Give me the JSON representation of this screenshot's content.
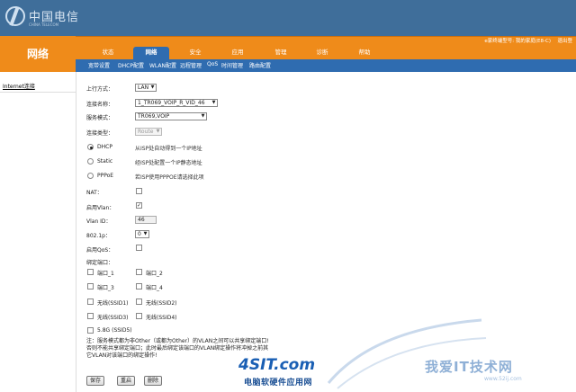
{
  "brand": {
    "name": "中国电信",
    "tagline": "CHINA TELECOM"
  },
  "header": {
    "section_title": "网络",
    "device_info": "e家终端型号: 我的家庭(E8-C)",
    "logout": "退出登"
  },
  "tabs": [
    "状态",
    "网络",
    "安全",
    "应用",
    "管理",
    "诊断",
    "帮助"
  ],
  "active_tab": "网络",
  "subnav": [
    "宽带设置",
    "DHCP配置",
    "WLAN配置",
    "远程管理",
    "QoS",
    "时间管理",
    "路由配置"
  ],
  "sidebar": {
    "link": "Internet连接"
  },
  "form": {
    "uplink_label": "上行方式：",
    "uplink_value": "LAN",
    "conn_name_label": "连接名称：",
    "conn_name_value": "1_TR069_VOIP_R_VID_46",
    "service_mode_label": "服务模式：",
    "service_mode_value": "TR069,VOIP",
    "conn_type_label": "连接类型：",
    "conn_type_value": "Route",
    "dhcp_label": "DHCP",
    "dhcp_desc": "从ISP处自动得到一个IP地址",
    "static_label": "Static",
    "static_desc": "经ISP处配置一个IP静态地址",
    "pppoe_label": "PPPoE",
    "pppoe_desc": "若ISP使用PPPOE请选择此项",
    "nat_label": "NAT：",
    "vlan_enable_label": "启用Vlan：",
    "vlan_id_label": "Vlan ID：",
    "vlan_id_value": "46",
    "p8021_label": "802.1p：",
    "p8021_value": "0",
    "qos_label": "启用QoS：",
    "bind_label": "绑定端口：",
    "ports": [
      "端口_1",
      "端口_2",
      "端口_3",
      "端口_4",
      "无线(SSID1)",
      "无线(SSID2)",
      "无线(SSID3)",
      "无线(SSID4)",
      "5.8G (SSID5)"
    ],
    "note_lines": [
      "注：服务模式都为非Other（或都为Other）的VLAN之间可以共享绑定端口!",
      "否则不能共享绑定端口；此时最后绑定该端口的VLAN绑定操作将冲掉之前其",
      "它VLAN对该端口的绑定操作!"
    ]
  },
  "buttons": {
    "save": "保存",
    "delete_row": "重启",
    "remove": "删除"
  },
  "watermark": {
    "logo_text": "4SIT.com",
    "logo_sub": "电脑软硬件应用网",
    "site_text": "我爱IT技术网",
    "site_url": "www.52ij.com"
  },
  "colors": {
    "header_blue": "#3f6e9a",
    "nav_orange": "#ef8b1a",
    "tab_blue": "#2f6cb0"
  }
}
